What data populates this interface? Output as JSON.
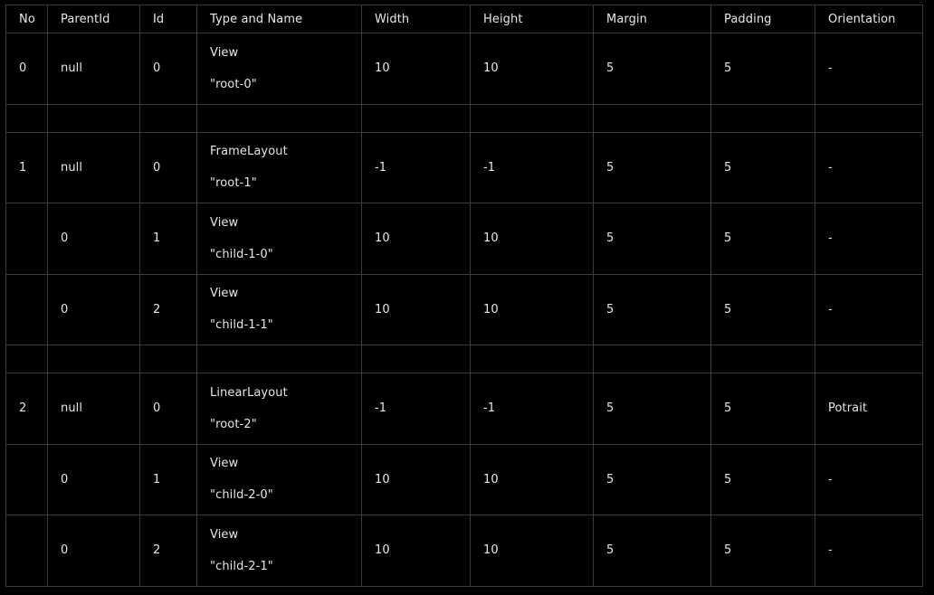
{
  "table": {
    "headers": [
      "No",
      "ParentId",
      "Id",
      "Type and Name",
      "Width",
      "Height",
      "Margin",
      "Padding",
      "Orientation"
    ],
    "rows": [
      {
        "no": "0",
        "parent_id": "null",
        "id": "0",
        "type": "View",
        "name": "\"root-0\"",
        "width": "10",
        "height": "10",
        "margin": "5",
        "padding": "5",
        "orientation": "-"
      },
      {
        "no": "",
        "parent_id": "",
        "id": "",
        "type": "",
        "name": "",
        "width": "",
        "height": "",
        "margin": "",
        "padding": "",
        "orientation": ""
      },
      {
        "no": "1",
        "parent_id": "null",
        "id": "0",
        "type": "FrameLayout",
        "name": "\"root-1\"",
        "width": "-1",
        "height": "-1",
        "margin": "5",
        "padding": "5",
        "orientation": "-"
      },
      {
        "no": "",
        "parent_id": "0",
        "id": "1",
        "type": "View",
        "name": "\"child-1-0\"",
        "width": "10",
        "height": "10",
        "margin": "5",
        "padding": "5",
        "orientation": "-"
      },
      {
        "no": "",
        "parent_id": "0",
        "id": "2",
        "type": "View",
        "name": "\"child-1-1\"",
        "width": "10",
        "height": "10",
        "margin": "5",
        "padding": "5",
        "orientation": "-"
      },
      {
        "no": "",
        "parent_id": "",
        "id": "",
        "type": "",
        "name": "",
        "width": "",
        "height": "",
        "margin": "",
        "padding": "",
        "orientation": ""
      },
      {
        "no": "2",
        "parent_id": "null",
        "id": "0",
        "type": "LinearLayout",
        "name": "\"root-2\"",
        "width": "-1",
        "height": "-1",
        "margin": "5",
        "padding": "5",
        "orientation": "Potrait"
      },
      {
        "no": "",
        "parent_id": "0",
        "id": "1",
        "type": "View",
        "name": "\"child-2-0\"",
        "width": "10",
        "height": "10",
        "margin": "5",
        "padding": "5",
        "orientation": "-"
      },
      {
        "no": "",
        "parent_id": "0",
        "id": "2",
        "type": "View",
        "name": "\"child-2-1\"",
        "width": "10",
        "height": "10",
        "margin": "5",
        "padding": "5",
        "orientation": "-"
      }
    ]
  },
  "colors": {
    "background": "#000000",
    "text": "#e6e6e6",
    "border": "#3b3b3b"
  }
}
